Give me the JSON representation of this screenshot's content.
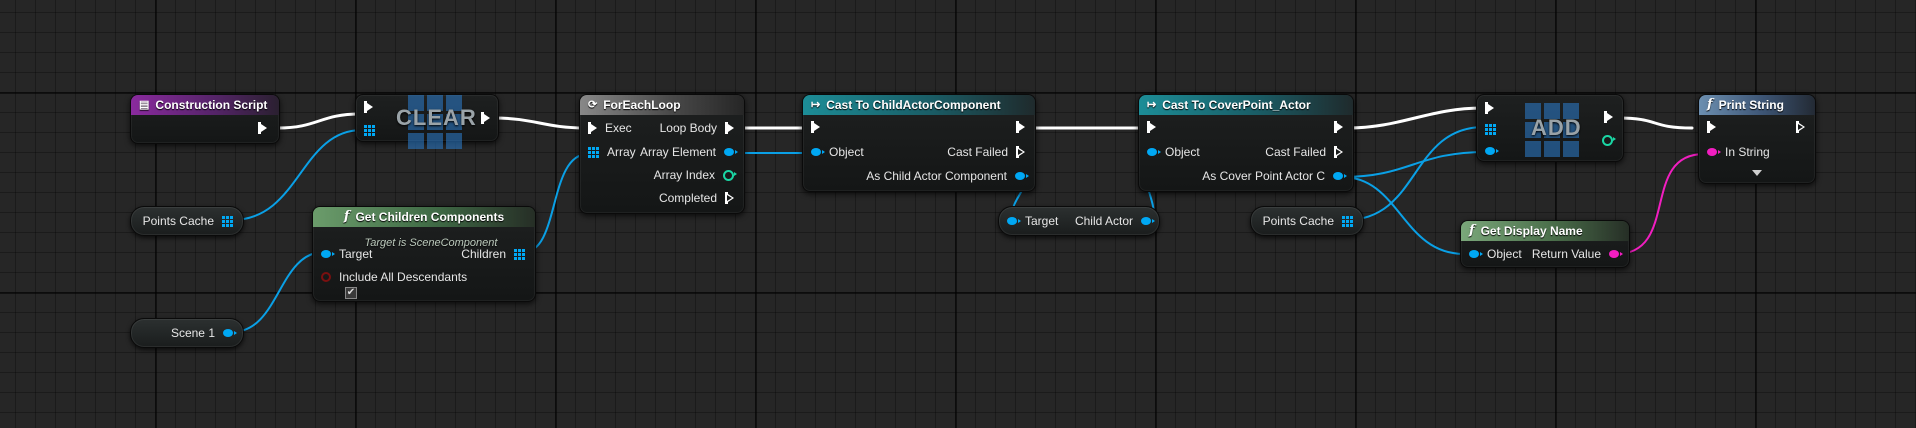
{
  "nodes": {
    "construction_script": {
      "title": "Construction Script"
    },
    "clear": {
      "title": "CLEAR"
    },
    "for_each_loop": {
      "title": "ForEachLoop",
      "exec": "Exec",
      "array": "Array",
      "loop_body": "Loop Body",
      "array_element": "Array Element",
      "array_index": "Array Index",
      "completed": "Completed"
    },
    "cast_child_actor_component": {
      "title": "Cast To ChildActorComponent",
      "object": "Object",
      "cast_failed": "Cast Failed",
      "as_output": "As Child Actor Component"
    },
    "cast_cover_point_actor": {
      "title": "Cast To CoverPoint_Actor",
      "object": "Object",
      "cast_failed": "Cast Failed",
      "as_output": "As Cover Point Actor C"
    },
    "add": {
      "title": "ADD"
    },
    "print_string": {
      "title": "Print String",
      "in_string": "In String"
    },
    "get_children_components": {
      "title": "Get Children Components",
      "subtitle": "Target is SceneComponent",
      "target": "Target",
      "children": "Children",
      "include_all": "Include All Descendants",
      "include_all_checked": "✔"
    },
    "get_display_name": {
      "title": "Get Display Name",
      "object": "Object",
      "return_value": "Return Value"
    },
    "points_cache_1": {
      "label": "Points Cache"
    },
    "points_cache_2": {
      "label": "Points Cache"
    },
    "scene_1": {
      "label": "Scene 1"
    },
    "child_actor": {
      "target": "Target",
      "child_actor": "Child Actor"
    }
  },
  "colors": {
    "exec_wire": "#ffffff",
    "object_wire": "#00a8f4",
    "string_wire": "#f21ec1",
    "event_header": "#8a2a9e",
    "cast_header": "#1c8d97",
    "function_header": "#7aa77a"
  }
}
